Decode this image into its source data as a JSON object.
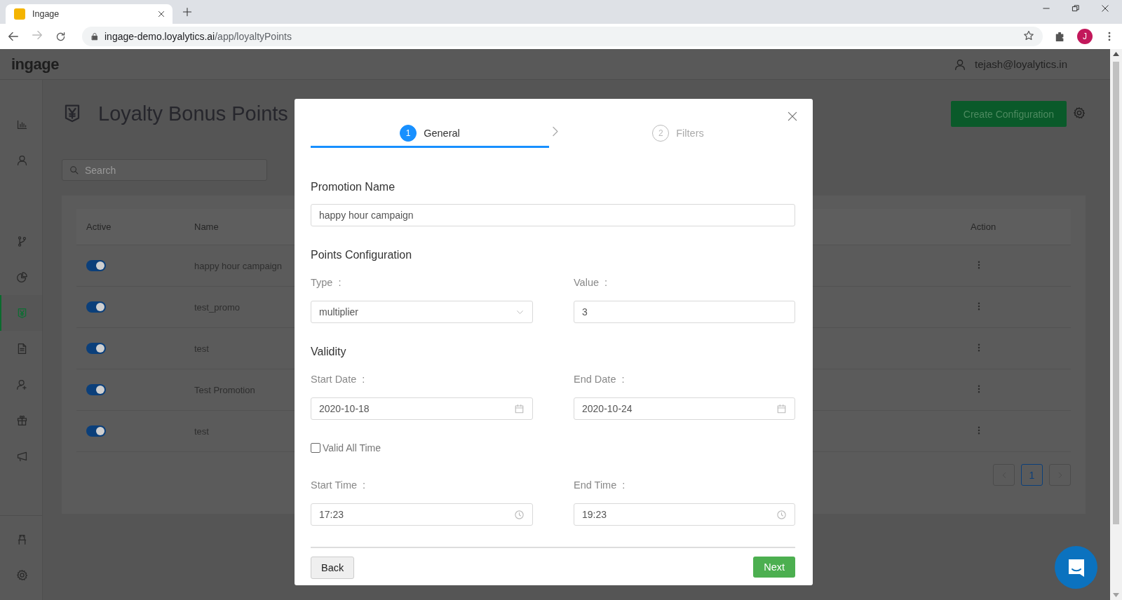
{
  "browser": {
    "tab_title": "Ingage",
    "url_host": "ingage-demo.loyalytics.ai",
    "url_path": "/app/loyaltyPoints",
    "profile_initial": "J"
  },
  "header": {
    "logo": "ingage",
    "user": "tejash@loyalytics.in"
  },
  "sidebar": {
    "items": [
      {
        "selected": false
      },
      {
        "selected": false
      },
      {
        "selected": false
      },
      {
        "selected": false
      },
      {
        "selected": true
      },
      {
        "selected": false
      },
      {
        "selected": false
      },
      {
        "selected": false
      },
      {
        "selected": false
      }
    ],
    "bottom_items": [
      {
        "selected": false
      },
      {
        "selected": false
      }
    ]
  },
  "page": {
    "title": "Loyalty Bonus Points",
    "create_button": "Create Configuration",
    "search": {
      "placeholder": "Search"
    }
  },
  "table": {
    "columns": [
      "Active",
      "Name",
      "Action"
    ],
    "rows": [
      {
        "active": true,
        "name": "happy hour campaign"
      },
      {
        "active": true,
        "name": "test_promo"
      },
      {
        "active": true,
        "name": "test"
      },
      {
        "active": true,
        "name": "Test Promotion"
      },
      {
        "active": true,
        "name": "test"
      }
    ]
  },
  "pagination": {
    "pages": [
      {
        "label": "1",
        "selected": true
      }
    ]
  },
  "modal": {
    "steps": [
      {
        "number": "1",
        "label": "General",
        "selected": true
      },
      {
        "number": "2",
        "label": "Filters",
        "selected": false
      }
    ],
    "promotion_name": {
      "label": "Promotion Name",
      "value": "happy hour campaign"
    },
    "points_heading": "Points Configuration",
    "type": {
      "label": "Type",
      "value": "multiplier"
    },
    "value": {
      "label": "Value",
      "value": "3"
    },
    "validity_heading": "Validity",
    "start_date": {
      "label": "Start Date",
      "value": "2020-10-18"
    },
    "end_date": {
      "label": "End Date",
      "value": "2020-10-24"
    },
    "valid_all_time": {
      "label": "Valid All Time",
      "checked": false
    },
    "start_time": {
      "label": "Start Time",
      "value": "17:23"
    },
    "end_time": {
      "label": "End Time",
      "value": "19:23"
    },
    "colon": ":",
    "back": "Back",
    "next": "Next"
  }
}
